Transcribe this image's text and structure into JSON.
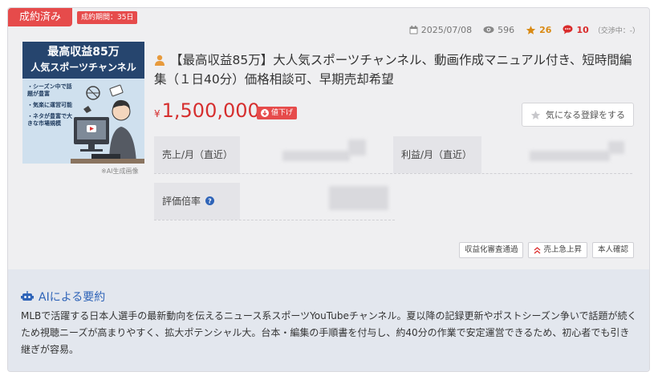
{
  "listing": {
    "status": "成約済み",
    "period": "成約期間：35日",
    "date": "2025/07/08",
    "views": "596",
    "stars": "26",
    "messages": "10",
    "messages_note": "（交渉中：-）",
    "thumbnail": {
      "headline1": "最高収益85万",
      "headline2": "人気スポーツチャンネル",
      "bullets": [
        "・シーズン中で話題が豊富",
        "・気楽に運営可能",
        "・ネタが豊富で大きな市場規模"
      ],
      "caption": "※AI生成画像"
    },
    "title": "【最高収益85万】大人気スポーツチャンネル、動画作成マニュアル付き、短時間編集（１日40分）価格相談可、早期売却希望",
    "price_symbol": "¥",
    "price": "1,500,000",
    "price_down": "値下げ",
    "watch_label": "気になる登録をする",
    "metrics": {
      "sales_label": "売上/月（直近）",
      "profit_label": "利益/月（直近）",
      "multiple_label": "評価倍率"
    },
    "tags": [
      "収益化審査通過",
      "売上急上昇",
      "本人確認"
    ]
  },
  "summary": {
    "heading": "AIによる要約",
    "text": "MLBで活躍する日本人選手の最新動向を伝えるニュース系スポーツYouTubeチャンネル。夏以降の記録更新やポストシーズン争いで話題が続くため視聴ニーズが高まりやすく、拡大ポテンシャル大。台本・編集の手順書を付与し、約40分の作業で安定運営できるため、初心者でも引き継ぎが容易。"
  },
  "colors": {
    "badge_red": "#e64b4b",
    "price_red": "#d62f2f",
    "star_orange": "#d98a14",
    "summary_blue": "#2f64b8"
  }
}
